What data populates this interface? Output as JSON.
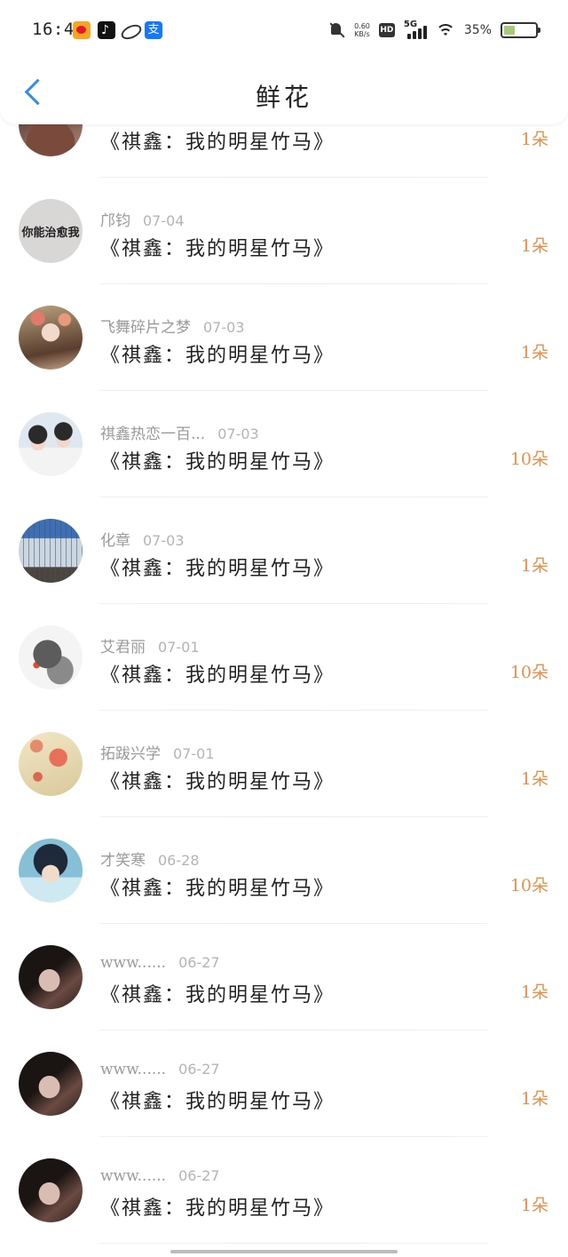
{
  "status_bar": {
    "time": "16:41",
    "net_speed_value": "0.60",
    "net_speed_unit": "KB/s",
    "hd": "HD",
    "network": "5G",
    "battery_percent": "35%",
    "battery_level": 0.35,
    "notification_icons": [
      "weibo-icon",
      "tiktok-icon",
      "oval-app-icon",
      "alipay-icon"
    ],
    "alipay_glyph": "支"
  },
  "header": {
    "title": "鲜花",
    "back_icon": "chevron-left-icon"
  },
  "colors": {
    "accent_blue": "#2f8ee6",
    "count_orange": "#e8904a",
    "meta_gray": "#9a9a9a"
  },
  "rows": [
    {
      "name": "",
      "date": "",
      "book": "《祺鑫：我的明星竹马》",
      "count": "1朵",
      "avatar_text": "",
      "avatar_kind": "girl-hanfu-dark"
    },
    {
      "name": "邝钧",
      "date": "07-04",
      "book": "《祺鑫：我的明星竹马》",
      "count": "1朵",
      "avatar_text": "你能治愈我",
      "avatar_kind": "text"
    },
    {
      "name": "飞舞碎片之梦",
      "date": "07-03",
      "book": "《祺鑫：我的明星竹马》",
      "count": "1朵",
      "avatar_text": "",
      "avatar_kind": "girl-flowers"
    },
    {
      "name": "祺鑫热恋一百...",
      "date": "07-03",
      "book": "《祺鑫：我的明星竹马》",
      "count": "10朵",
      "avatar_text": "",
      "avatar_kind": "two-boys"
    },
    {
      "name": "化章",
      "date": "07-03",
      "book": "《祺鑫：我的明星竹马》",
      "count": "1朵",
      "avatar_text": "",
      "avatar_kind": "winter-trees"
    },
    {
      "name": "艾君丽",
      "date": "07-01",
      "book": "《祺鑫：我的明星竹马》",
      "count": "10朵",
      "avatar_text": "",
      "avatar_kind": "cat-ink"
    },
    {
      "name": "拓跋兴学",
      "date": "07-01",
      "book": "《祺鑫：我的明星竹马》",
      "count": "1朵",
      "avatar_text": "",
      "avatar_kind": "flowers"
    },
    {
      "name": "才笑寒",
      "date": "06-28",
      "book": "《祺鑫：我的明星竹马》",
      "count": "10朵",
      "avatar_text": "",
      "avatar_kind": "anime-boy"
    },
    {
      "name": "www......",
      "date": "06-27",
      "book": "《祺鑫：我的明星竹马》",
      "count": "1朵",
      "avatar_text": "",
      "avatar_kind": "dark-portrait"
    },
    {
      "name": "www......",
      "date": "06-27",
      "book": "《祺鑫：我的明星竹马》",
      "count": "1朵",
      "avatar_text": "",
      "avatar_kind": "dark-portrait"
    },
    {
      "name": "www......",
      "date": "06-27",
      "book": "《祺鑫：我的明星竹马》",
      "count": "1朵",
      "avatar_text": "",
      "avatar_kind": "dark-portrait"
    }
  ]
}
